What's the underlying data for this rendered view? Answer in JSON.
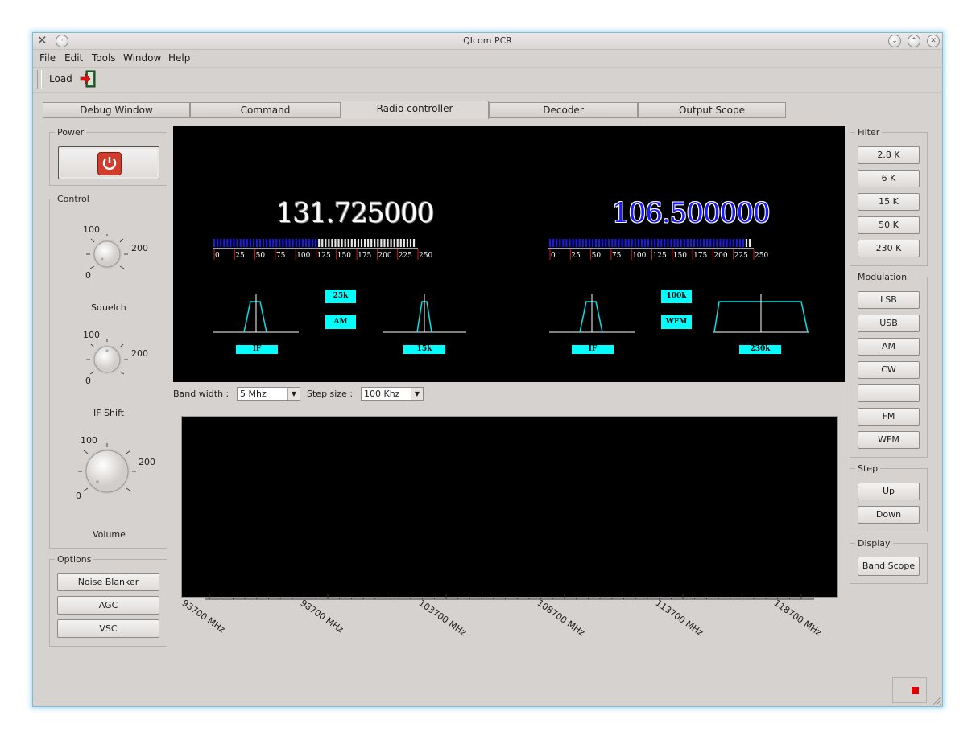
{
  "window": {
    "title": "QIcom PCR"
  },
  "menu": [
    "File",
    "Edit",
    "Tools",
    "Window",
    "Help"
  ],
  "toolbar": {
    "load_label": "Load"
  },
  "tabs": [
    "Debug Window",
    "Command",
    "Radio controller",
    "Decoder",
    "Output Scope"
  ],
  "active_tab": "Radio controller",
  "power": {
    "group_label": "Power"
  },
  "control": {
    "group_label": "Control",
    "knobs": [
      {
        "label": "Squelch",
        "min": "0",
        "mid": "100",
        "max": "200"
      },
      {
        "label": "IF Shift",
        "min": "0",
        "mid": "100",
        "max": "200"
      },
      {
        "label": "Volume",
        "min": "0",
        "mid": "100",
        "max": "200"
      }
    ]
  },
  "options": {
    "group_label": "Options",
    "buttons": [
      "Noise Blanker",
      "AGC",
      "VSC"
    ]
  },
  "receivers": [
    {
      "frequency": "131.725000",
      "freq_color": "#ffffff",
      "freq_outline": "#7d7d7d",
      "signal_meter": {
        "ticks": [
          "0",
          "25",
          "50",
          "75",
          "100",
          "125",
          "150",
          "175",
          "200",
          "225",
          "250"
        ],
        "level": 0.52
      },
      "step_badge": "25k",
      "mode_badge": "AM",
      "if_label": "IF",
      "filter_label": "15k"
    },
    {
      "frequency": "106.500000",
      "freq_color": "#1a1aff",
      "freq_outline": "#ffffff",
      "signal_meter": {
        "ticks": [
          "0",
          "25",
          "50",
          "75",
          "100",
          "125",
          "150",
          "175",
          "200",
          "225",
          "250"
        ],
        "level": 0.97
      },
      "step_badge": "100k",
      "mode_badge": "WFM",
      "if_label": "IF",
      "filter_label": "230k"
    }
  ],
  "scan": {
    "bandwidth_label": "Band width :",
    "bandwidth_value": "5 Mhz",
    "stepsize_label": "Step size :",
    "stepsize_value": "100 Khz"
  },
  "scope_axis": [
    "93700 MHz",
    "98700 MHz",
    "103700 MHz",
    "108700 MHz",
    "113700 MHz",
    "118700 MHz"
  ],
  "filter": {
    "group_label": "Filter",
    "buttons": [
      "2.8 K",
      "6 K",
      "15 K",
      "50 K",
      "230 K"
    ]
  },
  "modulation": {
    "group_label": "Modulation",
    "buttons": [
      "LSB",
      "USB",
      "AM",
      "CW",
      "",
      "FM",
      "WFM"
    ]
  },
  "step": {
    "group_label": "Step",
    "buttons": [
      "Up",
      "Down"
    ]
  },
  "display": {
    "group_label": "Display",
    "buttons": [
      "Band Scope"
    ]
  },
  "colors": {
    "accent_cyan": "#00ffff",
    "meter_blue": "#1c1cdc",
    "power_red": "#d23c2c"
  }
}
